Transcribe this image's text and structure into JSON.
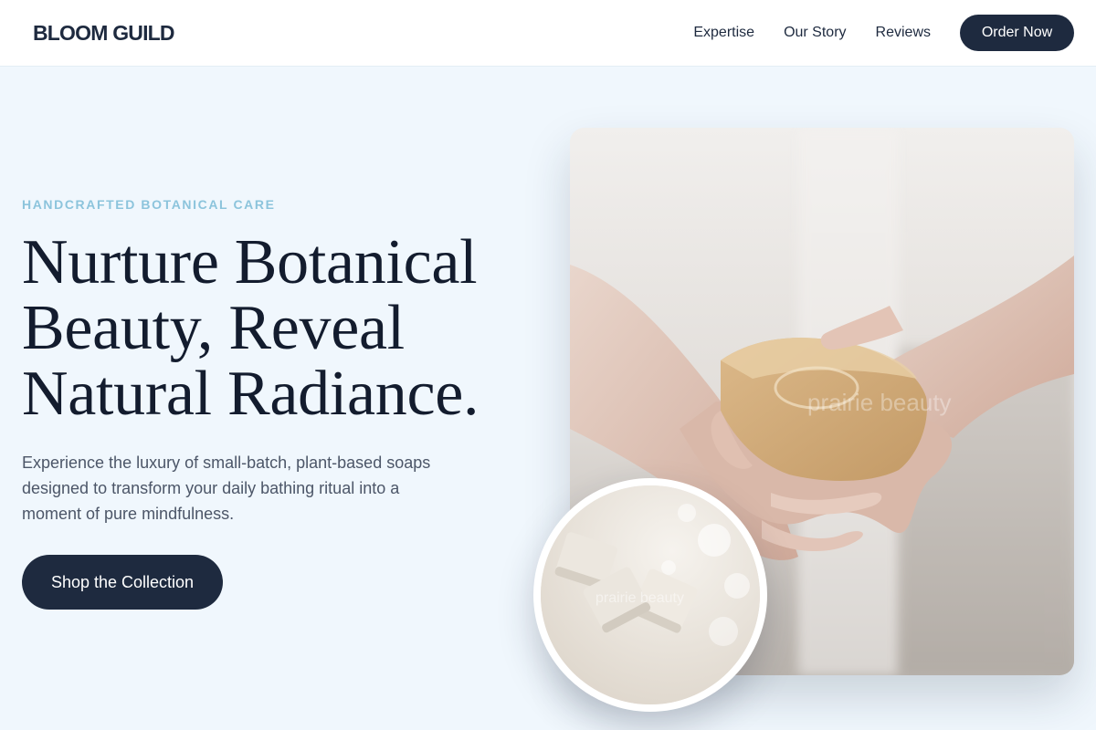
{
  "brand": {
    "name": "BLOOM GUILD"
  },
  "nav": {
    "links": [
      "Expertise",
      "Our Story",
      "Reviews"
    ],
    "cta_label": "Order Now"
  },
  "hero": {
    "eyebrow": "HANDCRAFTED BOTANICAL CARE",
    "headline_lines": [
      "Nurture Botanical",
      "Beauty, Reveal",
      "Natural Radiance."
    ],
    "description": "Experience the luxury of small-batch, plant-based soaps designed to transform your daily bathing ritual into a moment of pure mindfulness.",
    "cta_label": "Shop the Collection"
  },
  "images": {
    "main_watermark": "prairie beauty",
    "circle_watermark": "prairie beauty"
  },
  "colors": {
    "page_bg": "#f0f7fd",
    "primary_dark": "#1e2a3f",
    "eyebrow": "#8cc4dc",
    "body_text": "#4c5668"
  }
}
